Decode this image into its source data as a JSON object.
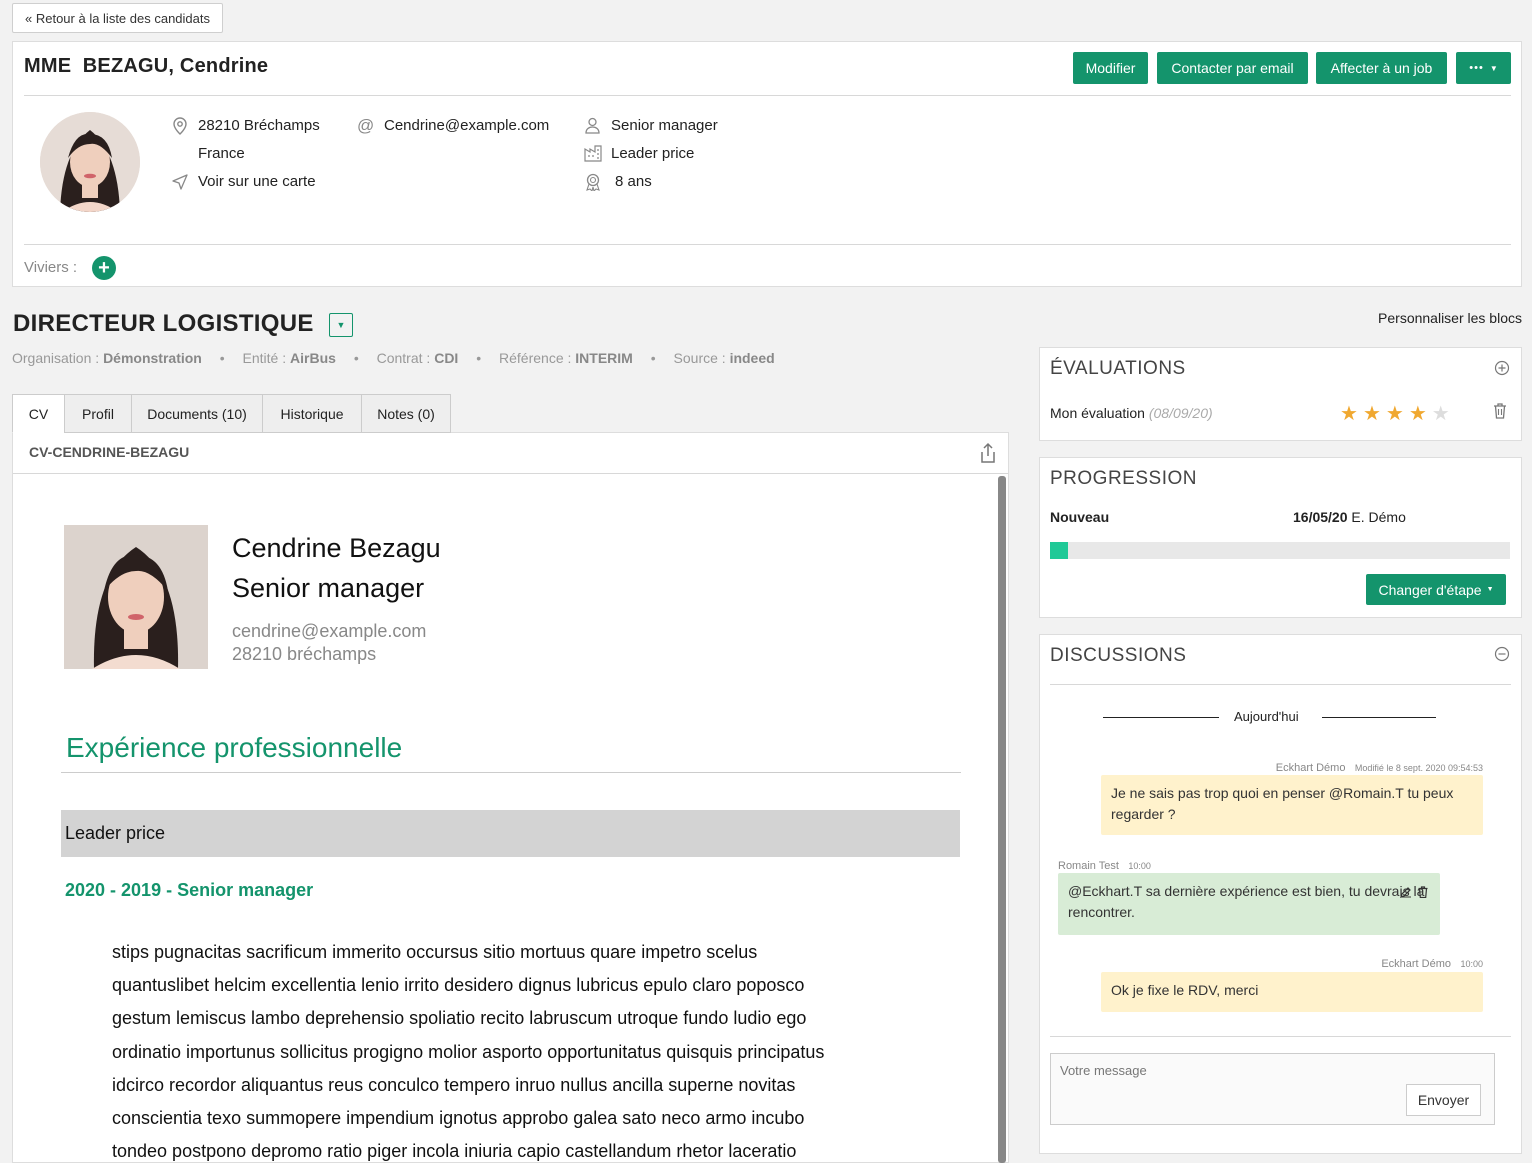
{
  "nav": {
    "back_label": "« Retour à la liste des candidats"
  },
  "candidate": {
    "full_name": "MME  BEZAGU, Cendrine",
    "postal_city": "28210 Bréchamps",
    "country": "France",
    "map_link": "Voir sur une carte",
    "email": "Cendrine@example.com",
    "position": "Senior manager",
    "company": "Leader price",
    "experience": "8 ans"
  },
  "actions": {
    "edit": "Modifier",
    "contact_email": "Contacter par email",
    "assign_job": "Affecter à un job",
    "more": "•••"
  },
  "viviers": {
    "label": "Viviers :"
  },
  "job": {
    "title": "DIRECTEUR LOGISTIQUE",
    "personalize": "Personnaliser les blocs",
    "meta": [
      {
        "key": "Organisation : ",
        "value": "Démonstration"
      },
      {
        "key": "Entité : ",
        "value": "AirBus"
      },
      {
        "key": "Contrat : ",
        "value": "CDI"
      },
      {
        "key": "Référence : ",
        "value": "INTERIM"
      },
      {
        "key": "Source : ",
        "value": "indeed"
      }
    ]
  },
  "tabs": [
    "CV",
    "Profil",
    "Documents (10)",
    "Historique",
    "Notes (0)"
  ],
  "cv": {
    "file_name": "CV-CENDRINE-BEZAGU",
    "name": "Cendrine Bezagu",
    "role": "Senior manager",
    "email": "cendrine@example.com",
    "city": "28210 bréchamps",
    "section_title": "Expérience professionnelle",
    "employer": "Leader price",
    "period": "2020 - 2019 - Senior manager",
    "lines": [
      "stips pugnacitas sacrificum immerito occursus sitio mortuus quare impetro scelus",
      "quantuslibet helcim excellentia lenio irrito desidero dignus lubricus epulo claro poposco",
      "gestum lemiscus lambo deprehensio spoliatio recito labruscum utroque fundo ludio ego",
      "ordinatio importunus sollicitus progigno molior asporto opportunitatus quisquis principatus",
      "idcirco recordor aliquantus reus conculco tempero inruo nullus ancilla superne novitas",
      "conscientia texo summopere impendium ignotus approbo galea sato neco armo incubo",
      "tondeo postpono depromo ratio piger incola iniuria capio castellandum rhetor laceratio"
    ]
  },
  "evaluations": {
    "title": "ÉVALUATIONS",
    "label": "Mon évaluation",
    "date": "(08/09/20)",
    "rating": 4,
    "max": 5,
    "star_color": "#f0a830"
  },
  "progression": {
    "title": "PROGRESSION",
    "stage": "Nouveau",
    "date": "16/05/20",
    "by": "E. Démo",
    "progress_fraction": 0.04,
    "button": "Changer d'étape"
  },
  "discussions": {
    "title": "DISCUSSIONS",
    "day_label": "Aujourd'hui",
    "messages": [
      {
        "author": "Eckhart Démo",
        "time": "Modifié le 8 sept. 2020 09:54:53",
        "text": "Je ne sais pas trop quoi en penser @Romain.T tu peux regarder ?"
      },
      {
        "author": "Romain Test",
        "time": "10:00",
        "text": "@Eckhart.T sa dernière expérience est bien, tu devrais la rencontrer."
      },
      {
        "author": "Eckhart Démo",
        "time": "10:00",
        "text": "Ok je fixe le RDV, merci"
      }
    ],
    "placeholder": "Votre message",
    "send": "Envoyer"
  },
  "colors": {
    "accent": "#14946c",
    "progress": "#20c997",
    "own_bubble": "#fff2cc",
    "other_bubble": "#d8ecd6"
  }
}
